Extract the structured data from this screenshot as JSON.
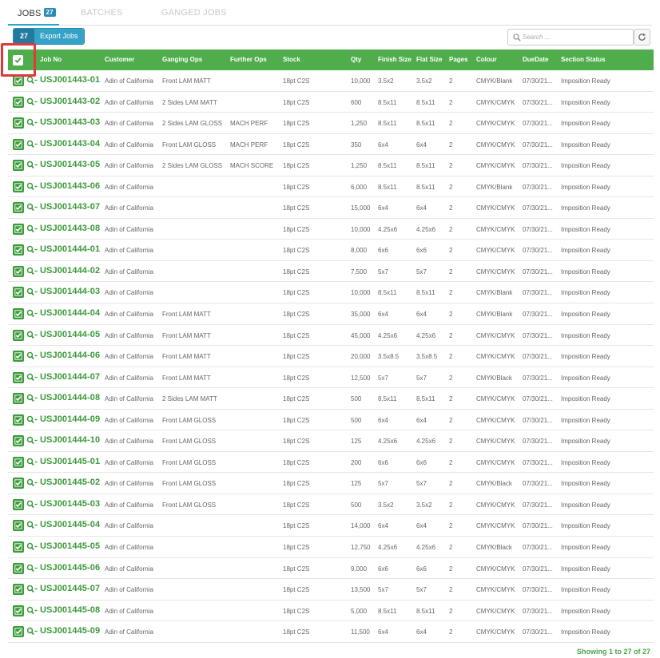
{
  "tabs": [
    {
      "label": "JOBS",
      "badge": "27",
      "active": true
    },
    {
      "label": "BATCHES",
      "active": false
    },
    {
      "label": "GANGED JOBS",
      "active": false
    }
  ],
  "toolbar": {
    "export_count": "27",
    "export_label": "Export Jobs",
    "search_placeholder": "Search ...",
    "search_icon": "search-icon",
    "refresh_icon": "refresh-icon"
  },
  "colors": {
    "header_green": "#4fae4b",
    "job_green": "#3b9a3a",
    "highlight_red": "#e0393c",
    "tab_blue": "#2a8bb6"
  },
  "table": {
    "columns": [
      "Job No",
      "Customer",
      "Ganging Ops",
      "Further Ops",
      "Stock",
      "Qty",
      "Finish Size",
      "Flat Size",
      "Pages",
      "Colour",
      "DueDate",
      "Section Status"
    ],
    "rows": [
      {
        "job": "USJ001443-01",
        "customer": "Adin of California",
        "ganging": "Front LAM MATT",
        "further": "",
        "stock": "18pt C2S",
        "qty": "10,000",
        "finish": "3.5x2",
        "flat": "3.5x2",
        "pages": "2",
        "colour": "CMYK/Blank",
        "due": "07/30/21...",
        "status": "Imposition Ready"
      },
      {
        "job": "USJ001443-02",
        "customer": "Adin of California",
        "ganging": "2 Sides LAM MATT",
        "further": "",
        "stock": "18pt C2S",
        "qty": "600",
        "finish": "8.5x11",
        "flat": "8.5x11",
        "pages": "2",
        "colour": "CMYK/CMYK",
        "due": "07/30/21...",
        "status": "Imposition Ready"
      },
      {
        "job": "USJ001443-03",
        "customer": "Adin of California",
        "ganging": "2 Sides LAM GLOSS",
        "further": "MACH PERF",
        "stock": "18pt C2S",
        "qty": "1,250",
        "finish": "8.5x11",
        "flat": "8.5x11",
        "pages": "2",
        "colour": "CMYK/CMYK",
        "due": "07/30/21...",
        "status": "Imposition Ready"
      },
      {
        "job": "USJ001443-04",
        "customer": "Adin of California",
        "ganging": "Front LAM GLOSS",
        "further": "MACH PERF",
        "stock": "18pt C2S",
        "qty": "350",
        "finish": "6x4",
        "flat": "6x4",
        "pages": "2",
        "colour": "CMYK/CMYK",
        "due": "07/30/21...",
        "status": "Imposition Ready"
      },
      {
        "job": "USJ001443-05",
        "customer": "Adin of California",
        "ganging": "2 Sides LAM GLOSS",
        "further": "MACH SCORE",
        "stock": "18pt C2S",
        "qty": "1,250",
        "finish": "8.5x11",
        "flat": "8.5x11",
        "pages": "2",
        "colour": "CMYK/CMYK",
        "due": "07/30/21...",
        "status": "Imposition Ready"
      },
      {
        "job": "USJ001443-06",
        "customer": "Adin of California",
        "ganging": "",
        "further": "",
        "stock": "18pt C2S",
        "qty": "6,000",
        "finish": "8.5x11",
        "flat": "8.5x11",
        "pages": "2",
        "colour": "CMYK/Blank",
        "due": "07/30/21...",
        "status": "Imposition Ready"
      },
      {
        "job": "USJ001443-07",
        "customer": "Adin of California",
        "ganging": "",
        "further": "",
        "stock": "18pt C2S",
        "qty": "15,000",
        "finish": "6x4",
        "flat": "6x4",
        "pages": "2",
        "colour": "CMYK/CMYK",
        "due": "07/30/21...",
        "status": "Imposition Ready"
      },
      {
        "job": "USJ001443-08",
        "customer": "Adin of California",
        "ganging": "",
        "further": "",
        "stock": "18pt C2S",
        "qty": "10,000",
        "finish": "4.25x6",
        "flat": "4.25x6",
        "pages": "2",
        "colour": "CMYK/CMYK",
        "due": "07/30/21...",
        "status": "Imposition Ready"
      },
      {
        "job": "USJ001444-01",
        "customer": "Adin of California",
        "ganging": "",
        "further": "",
        "stock": "18pt C2S",
        "qty": "8,000",
        "finish": "6x6",
        "flat": "6x6",
        "pages": "2",
        "colour": "CMYK/CMYK",
        "due": "07/30/21...",
        "status": "Imposition Ready"
      },
      {
        "job": "USJ001444-02",
        "customer": "Adin of California",
        "ganging": "",
        "further": "",
        "stock": "18pt C2S",
        "qty": "7,500",
        "finish": "5x7",
        "flat": "5x7",
        "pages": "2",
        "colour": "CMYK/CMYK",
        "due": "07/30/21...",
        "status": "Imposition Ready"
      },
      {
        "job": "USJ001444-03",
        "customer": "Adin of California",
        "ganging": "",
        "further": "",
        "stock": "18pt C2S",
        "qty": "10,000",
        "finish": "8.5x11",
        "flat": "8.5x11",
        "pages": "2",
        "colour": "CMYK/Blank",
        "due": "07/30/21...",
        "status": "Imposition Ready"
      },
      {
        "job": "USJ001444-04",
        "customer": "Adin of California",
        "ganging": "Front LAM MATT",
        "further": "",
        "stock": "18pt C2S",
        "qty": "35,000",
        "finish": "6x4",
        "flat": "6x4",
        "pages": "2",
        "colour": "CMYK/Blank",
        "due": "07/30/21...",
        "status": "Imposition Ready"
      },
      {
        "job": "USJ001444-05",
        "customer": "Adin of California",
        "ganging": "Front LAM MATT",
        "further": "",
        "stock": "18pt C2S",
        "qty": "45,000",
        "finish": "4.25x6",
        "flat": "4.25x6",
        "pages": "2",
        "colour": "CMYK/CMYK",
        "due": "07/30/21...",
        "status": "Imposition Ready"
      },
      {
        "job": "USJ001444-06",
        "customer": "Adin of California",
        "ganging": "Front LAM MATT",
        "further": "",
        "stock": "18pt C2S",
        "qty": "20,000",
        "finish": "3.5x8.5",
        "flat": "3.5x8.5",
        "pages": "2",
        "colour": "CMYK/CMYK",
        "due": "07/30/21...",
        "status": "Imposition Ready"
      },
      {
        "job": "USJ001444-07",
        "customer": "Adin of California",
        "ganging": "Front LAM MATT",
        "further": "",
        "stock": "18pt C2S",
        "qty": "12,500",
        "finish": "5x7",
        "flat": "5x7",
        "pages": "2",
        "colour": "CMYK/Black",
        "due": "07/30/21...",
        "status": "Imposition Ready"
      },
      {
        "job": "USJ001444-08",
        "customer": "Adin of California",
        "ganging": "2 Sides LAM MATT",
        "further": "",
        "stock": "18pt C2S",
        "qty": "500",
        "finish": "8.5x11",
        "flat": "8.5x11",
        "pages": "2",
        "colour": "CMYK/CMYK",
        "due": "07/30/21...",
        "status": "Imposition Ready"
      },
      {
        "job": "USJ001444-09",
        "customer": "Adin of California",
        "ganging": "Front LAM GLOSS",
        "further": "",
        "stock": "18pt C2S",
        "qty": "500",
        "finish": "6x4",
        "flat": "6x4",
        "pages": "2",
        "colour": "CMYK/CMYK",
        "due": "07/30/21...",
        "status": "Imposition Ready"
      },
      {
        "job": "USJ001444-10",
        "customer": "Adin of California",
        "ganging": "Front LAM GLOSS",
        "further": "",
        "stock": "18pt C2S",
        "qty": "125",
        "finish": "4.25x6",
        "flat": "4.25x6",
        "pages": "2",
        "colour": "CMYK/CMYK",
        "due": "07/30/21...",
        "status": "Imposition Ready"
      },
      {
        "job": "USJ001445-01",
        "customer": "Adin of California",
        "ganging": "Front LAM GLOSS",
        "further": "",
        "stock": "18pt C2S",
        "qty": "200",
        "finish": "6x6",
        "flat": "6x6",
        "pages": "2",
        "colour": "CMYK/CMYK",
        "due": "07/30/21...",
        "status": "Imposition Ready"
      },
      {
        "job": "USJ001445-02",
        "customer": "Adin of California",
        "ganging": "Front LAM GLOSS",
        "further": "",
        "stock": "18pt C2S",
        "qty": "125",
        "finish": "5x7",
        "flat": "5x7",
        "pages": "2",
        "colour": "CMYK/Black",
        "due": "07/30/21...",
        "status": "Imposition Ready"
      },
      {
        "job": "USJ001445-03",
        "customer": "Adin of California",
        "ganging": "Front LAM GLOSS",
        "further": "",
        "stock": "18pt C2S",
        "qty": "500",
        "finish": "3.5x2",
        "flat": "3.5x2",
        "pages": "2",
        "colour": "CMYK/CMYK",
        "due": "07/30/21...",
        "status": "Imposition Ready"
      },
      {
        "job": "USJ001445-04",
        "customer": "Adin of California",
        "ganging": "",
        "further": "",
        "stock": "18pt C2S",
        "qty": "14,000",
        "finish": "6x4",
        "flat": "6x4",
        "pages": "2",
        "colour": "CMYK/CMYK",
        "due": "07/30/21...",
        "status": "Imposition Ready"
      },
      {
        "job": "USJ001445-05",
        "customer": "Adin of California",
        "ganging": "",
        "further": "",
        "stock": "18pt C2S",
        "qty": "12,750",
        "finish": "4.25x6",
        "flat": "4.25x6",
        "pages": "2",
        "colour": "CMYK/Black",
        "due": "07/30/21...",
        "status": "Imposition Ready"
      },
      {
        "job": "USJ001445-06",
        "customer": "Adin of California",
        "ganging": "",
        "further": "",
        "stock": "18pt C2S",
        "qty": "9,000",
        "finish": "6x6",
        "flat": "6x6",
        "pages": "2",
        "colour": "CMYK/CMYK",
        "due": "07/30/21...",
        "status": "Imposition Ready"
      },
      {
        "job": "USJ001445-07",
        "customer": "Adin of California",
        "ganging": "",
        "further": "",
        "stock": "18pt C2S",
        "qty": "13,500",
        "finish": "5x7",
        "flat": "5x7",
        "pages": "2",
        "colour": "CMYK/CMYK",
        "due": "07/30/21...",
        "status": "Imposition Ready"
      },
      {
        "job": "USJ001445-08",
        "customer": "Adin of California",
        "ganging": "",
        "further": "",
        "stock": "18pt C2S",
        "qty": "5,000",
        "finish": "8.5x11",
        "flat": "8.5x11",
        "pages": "2",
        "colour": "CMYK/CMYK",
        "due": "07/30/21...",
        "status": "Imposition Ready"
      },
      {
        "job": "USJ001445-09",
        "customer": "Adin of California",
        "ganging": "",
        "further": "",
        "stock": "18pt C2S",
        "qty": "11,500",
        "finish": "6x4",
        "flat": "6x4",
        "pages": "2",
        "colour": "CMYK/CMYK",
        "due": "07/30/21...",
        "status": "Imposition Ready"
      }
    ]
  },
  "footer": {
    "showing": "Showing 1 to 27 of 27"
  }
}
